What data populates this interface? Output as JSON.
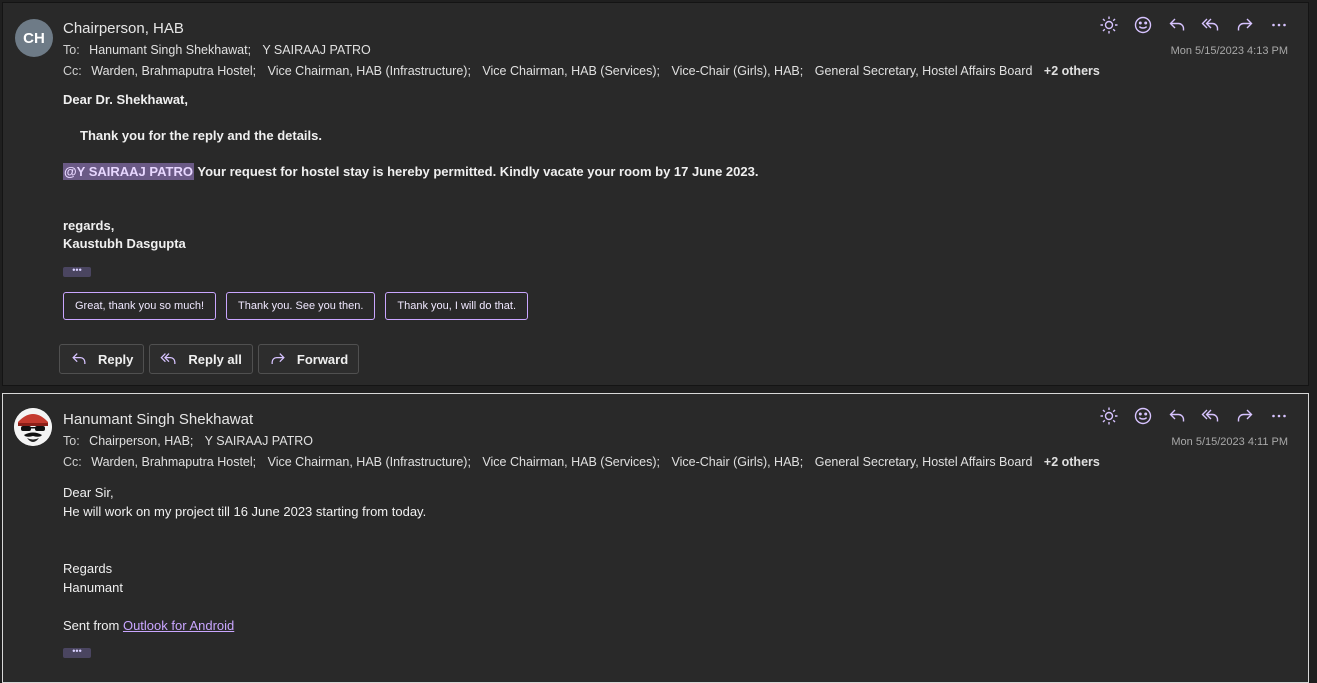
{
  "messages": [
    {
      "avatar_initials": "CH",
      "sender": "Chairperson, HAB",
      "to_label": "To:",
      "to": [
        "Hanumant Singh Shekhawat;",
        "Y SAIRAAJ PATRO"
      ],
      "cc_label": "Cc:",
      "cc": [
        "Warden, Brahmaputra Hostel;",
        "Vice Chairman, HAB (Infrastructure);",
        "Vice Chairman, HAB (Services);",
        "Vice-Chair (Girls), HAB;",
        "General Secretary, Hostel Affairs Board"
      ],
      "cc_more": "+2 others",
      "date": "Mon 5/15/2023 4:13 PM",
      "greeting": "Dear Dr. Shekhawat,",
      "line1": "Thank you for the reply and the details.",
      "mention": "@Y SAIRAAJ PATRO",
      "line2": " Your request for hostel stay is hereby permitted. Kindly vacate your room by 17 June 2023.",
      "closing": "regards,",
      "signature": "Kaustubh Dasgupta",
      "more_dots": "•••",
      "suggestions": [
        "Great, thank you so much!",
        "Thank you. See you then.",
        "Thank you, I will do that."
      ],
      "buttons": {
        "reply": "Reply",
        "reply_all": "Reply all",
        "forward": "Forward"
      }
    },
    {
      "sender": "Hanumant Singh Shekhawat",
      "to_label": "To:",
      "to": [
        "Chairperson, HAB;",
        "Y SAIRAAJ PATRO"
      ],
      "cc_label": "Cc:",
      "cc": [
        "Warden, Brahmaputra Hostel;",
        "Vice Chairman, HAB (Infrastructure);",
        "Vice Chairman, HAB (Services);",
        "Vice-Chair (Girls), HAB;",
        "General Secretary, Hostel Affairs Board"
      ],
      "cc_more": "+2 others",
      "date": "Mon 5/15/2023 4:11 PM",
      "greeting": "Dear Sir,",
      "line1": "He will work on my project till 16 June 2023 starting from today.",
      "closing": "Regards",
      "signature": "Hanumant",
      "sent_from": "Sent from ",
      "sent_link": "Outlook for Android",
      "more_dots": "•••"
    }
  ],
  "icons": [
    "sun-icon",
    "emoji-icon",
    "reply-icon",
    "reply-all-icon",
    "forward-icon",
    "more-icon"
  ]
}
